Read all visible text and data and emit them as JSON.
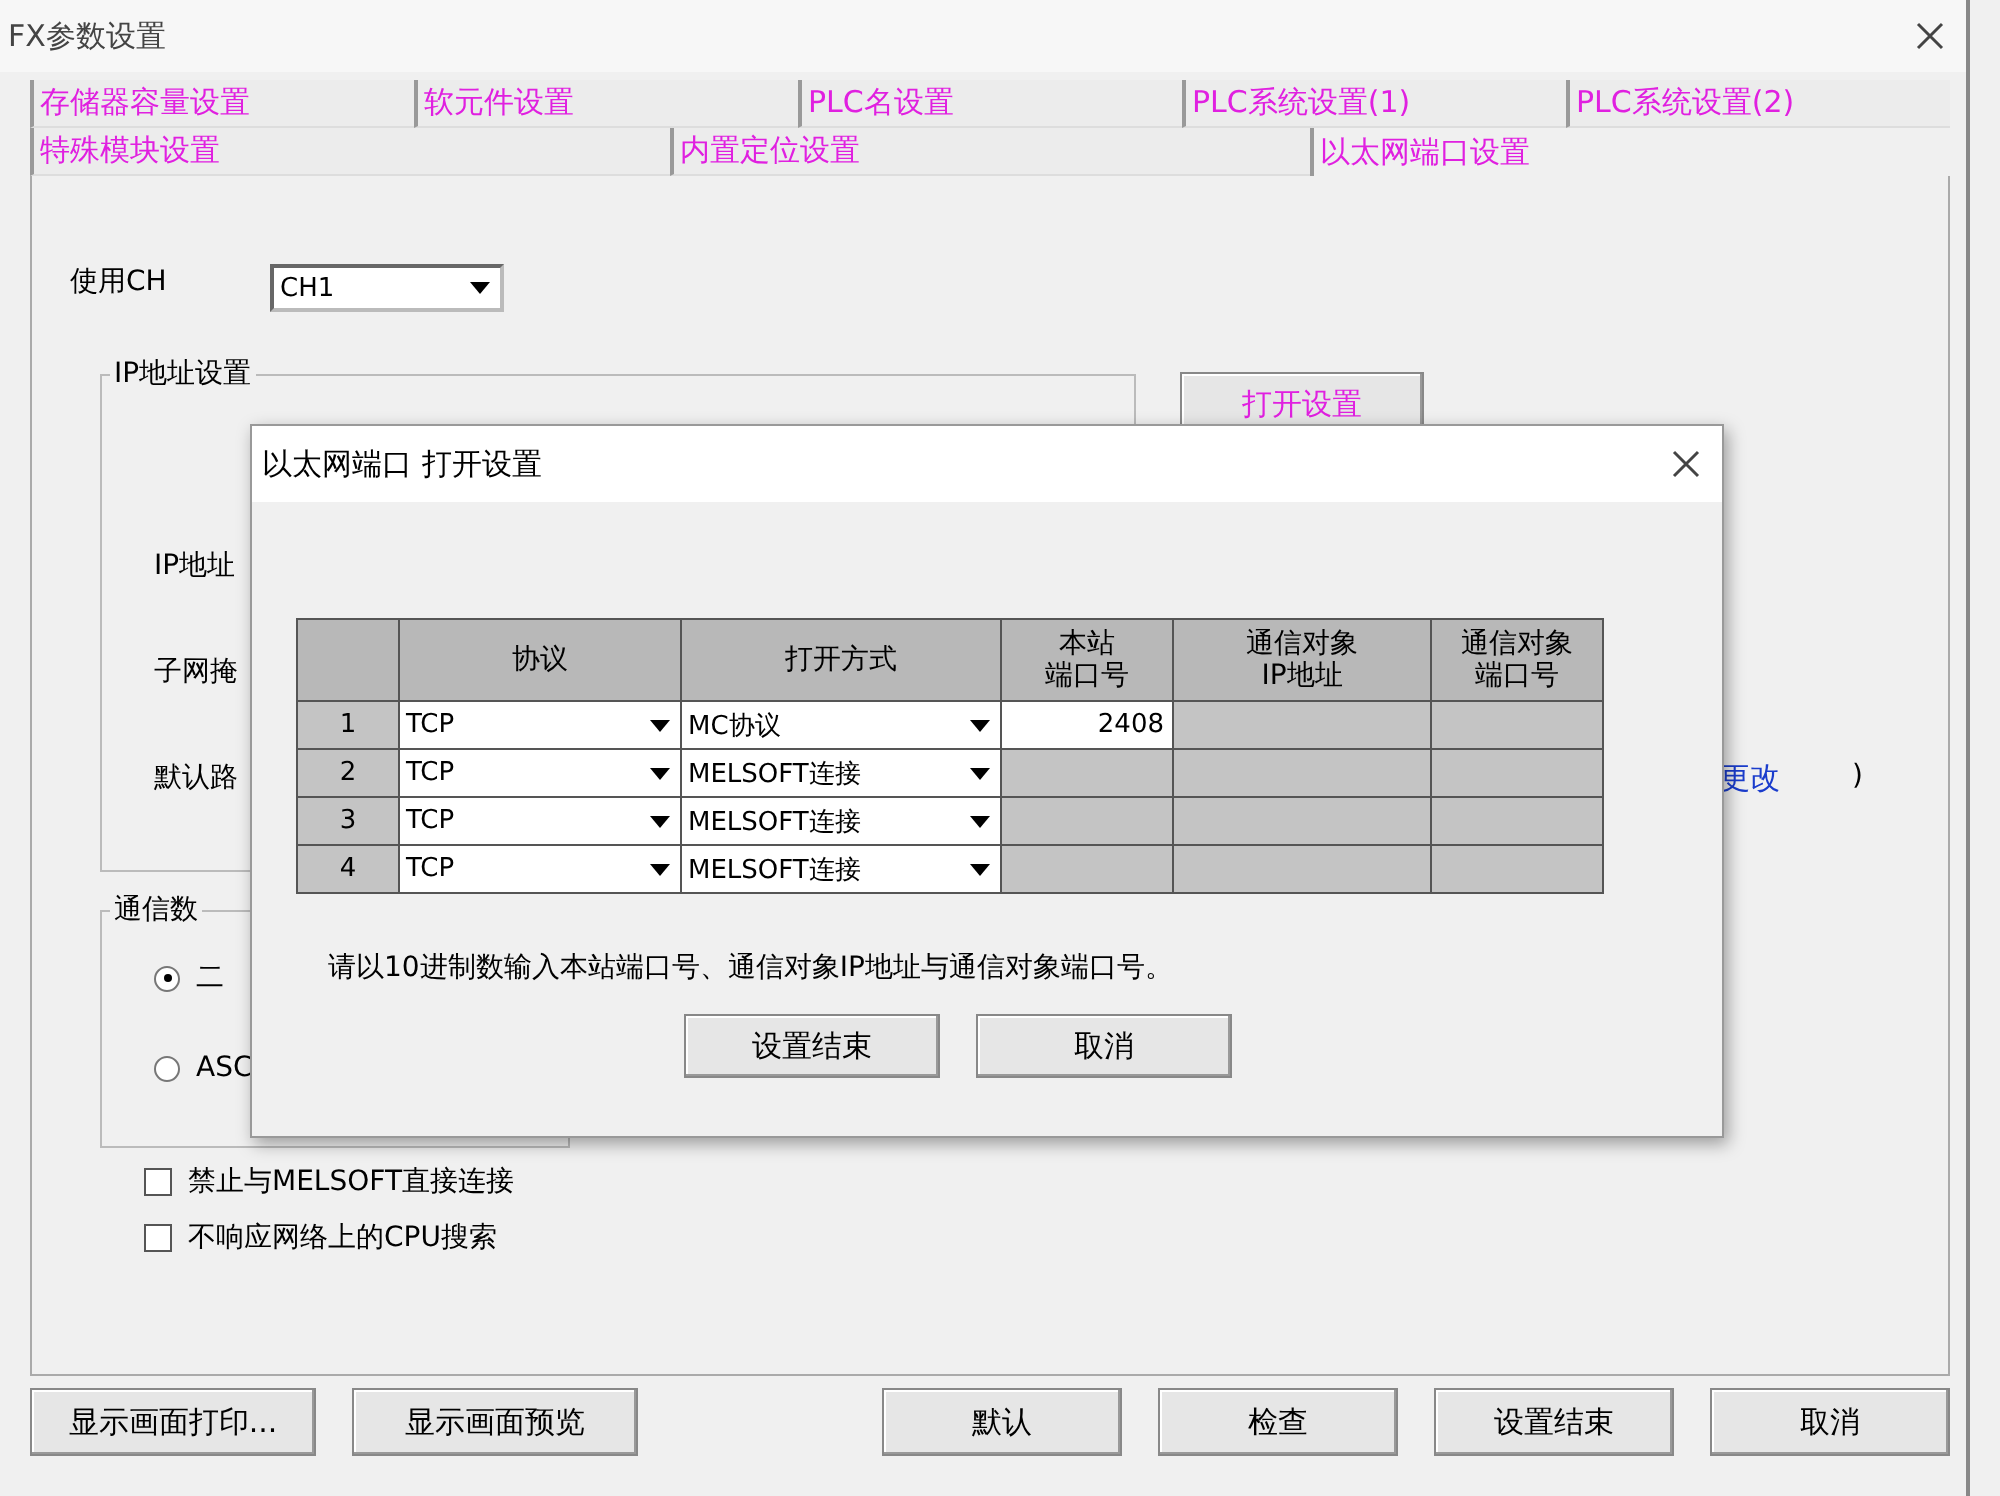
{
  "window": {
    "title": "FX参数设置"
  },
  "tab_rows": [
    {
      "tabs": [
        {
          "label": "存储器容量设置",
          "selected": false
        },
        {
          "label": "软元件设置",
          "selected": false
        },
        {
          "label": "PLC名设置",
          "selected": false
        },
        {
          "label": "PLC系统设置(1)",
          "selected": false
        },
        {
          "label": "PLC系统设置(2)",
          "selected": false
        }
      ]
    },
    {
      "tabs": [
        {
          "label": "特殊模块设置",
          "selected": false
        },
        {
          "label": "内置定位设置",
          "selected": false
        },
        {
          "label": "以太网端口设置",
          "selected": true
        }
      ]
    }
  ],
  "channel": {
    "label": "使用CH",
    "value": "CH1"
  },
  "ip_group": {
    "title": "IP地址设置",
    "labels": [
      "IP地址",
      "子网掩",
      "默认路"
    ],
    "open_button": "打开设置",
    "change_link": "更改",
    "paren": ")"
  },
  "comm_group": {
    "title": "通信数",
    "options": [
      {
        "label": "二",
        "selected": true
      },
      {
        "label": "ASC",
        "selected": false
      }
    ]
  },
  "checkboxes": [
    {
      "label": "禁止与MELSOFT直接连接",
      "checked": false
    },
    {
      "label": "不响应网络上的CPU搜索",
      "checked": false
    }
  ],
  "footer": {
    "left_buttons": [
      "显示画面打印...",
      "显示画面预览"
    ],
    "right_buttons": [
      "默认",
      "检查",
      "设置结束",
      "取消"
    ]
  },
  "dialog": {
    "title": "以太网端口 打开设置",
    "columns": [
      {
        "lines": [
          "协议"
        ]
      },
      {
        "lines": [
          "打开方式"
        ]
      },
      {
        "lines": [
          "本站",
          "端口号"
        ]
      },
      {
        "lines": [
          "通信对象",
          "IP地址"
        ]
      },
      {
        "lines": [
          "通信对象",
          "端口号"
        ]
      }
    ],
    "rows": [
      {
        "number": "1",
        "protocol": "TCP",
        "method": "MC协议",
        "port": {
          "value": "2408",
          "disabled": false
        },
        "remote_ip": {
          "disabled": true
        },
        "remote_port": {
          "disabled": true
        }
      },
      {
        "number": "2",
        "protocol": "TCP",
        "method": "MELSOFT连接",
        "port": {
          "disabled": true
        },
        "remote_ip": {
          "disabled": true
        },
        "remote_port": {
          "disabled": true
        }
      },
      {
        "number": "3",
        "protocol": "TCP",
        "method": "MELSOFT连接",
        "port": {
          "disabled": true
        },
        "remote_ip": {
          "disabled": true
        },
        "remote_port": {
          "disabled": true
        }
      },
      {
        "number": "4",
        "protocol": "TCP",
        "method": "MELSOFT连接",
        "port": {
          "disabled": true
        },
        "remote_ip": {
          "disabled": true
        },
        "remote_port": {
          "disabled": true
        }
      }
    ],
    "note": "请以10进制数输入本站端口号、通信对象IP地址与通信对象端口号。",
    "buttons": [
      "设置结束",
      "取消"
    ]
  }
}
